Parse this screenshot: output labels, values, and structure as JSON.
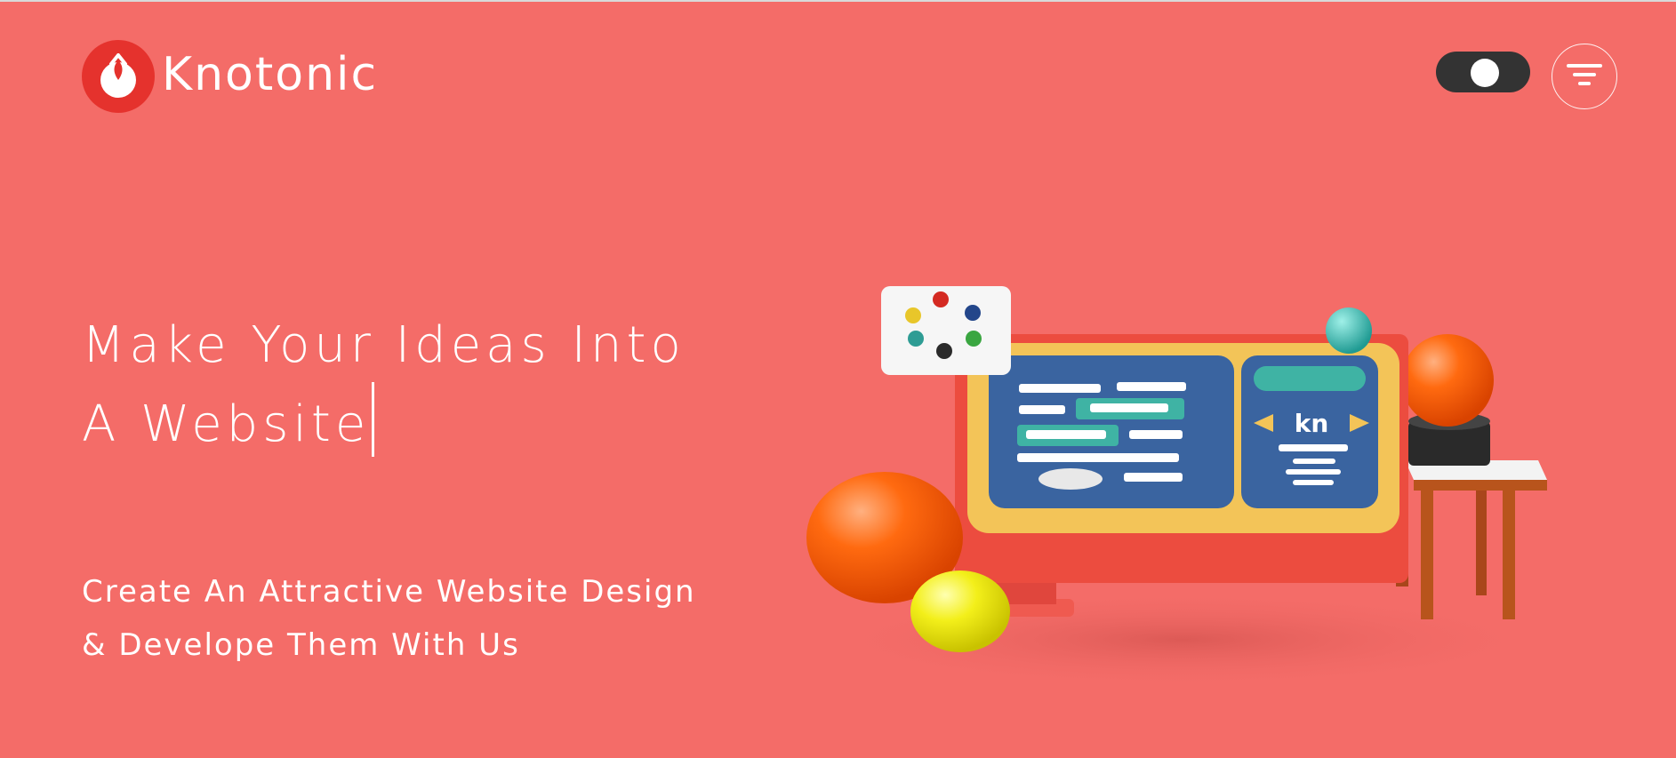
{
  "brand": {
    "name": "Knotonic",
    "logo_mark_color": "#E5322D"
  },
  "header": {
    "theme_toggle": {
      "state": "dark-mode-toggle",
      "icon": "toggle-icon"
    },
    "menu_button": {
      "icon": "filter-menu-icon"
    }
  },
  "hero": {
    "headline_line1": "Make Your Ideas Into",
    "headline_line2": "A Website",
    "subhead_line1": "Create An Attractive Website Design",
    "subhead_line2": "& Develope Them With Us"
  },
  "illustration": {
    "screen_label": "kn"
  },
  "colors": {
    "background": "#F46C68",
    "toggle": "#333333",
    "text": "#FFFFFF"
  }
}
